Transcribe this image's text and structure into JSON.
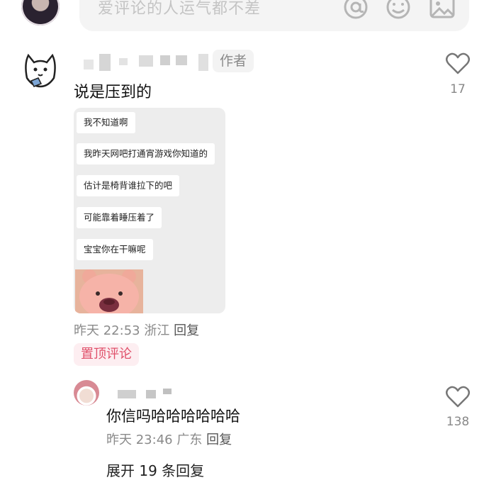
{
  "top_bar": {
    "placeholder": "爱评论的人运气都不差",
    "icons": [
      "at-icon",
      "emoji-icon",
      "image-icon"
    ]
  },
  "comment": {
    "author_tag": "作者",
    "text": "说是压到的",
    "likes": "17",
    "chat_screenshot": {
      "messages": [
        "我不知道啊",
        "我昨天网吧打通宵游戏你知道的",
        "估计是椅背谁拉下的吧",
        "可能靠着睡压着了",
        "宝宝你在干嘛呢"
      ],
      "sticker": "pink-bear-sticker"
    },
    "time": "昨天 22:53",
    "location": "浙江",
    "reply_label": "回复",
    "pinned_label": "置顶评论"
  },
  "reply": {
    "text": "你信吗哈哈哈哈哈哈",
    "likes": "138",
    "time": "昨天 23:46",
    "location": "广东",
    "reply_label": "回复"
  },
  "expand_label": "展开 19 条回复",
  "colors": {
    "accent_pink": "#e0506a",
    "pinned_bg": "#fdeef1",
    "muted_text": "#8a8a8a"
  }
}
